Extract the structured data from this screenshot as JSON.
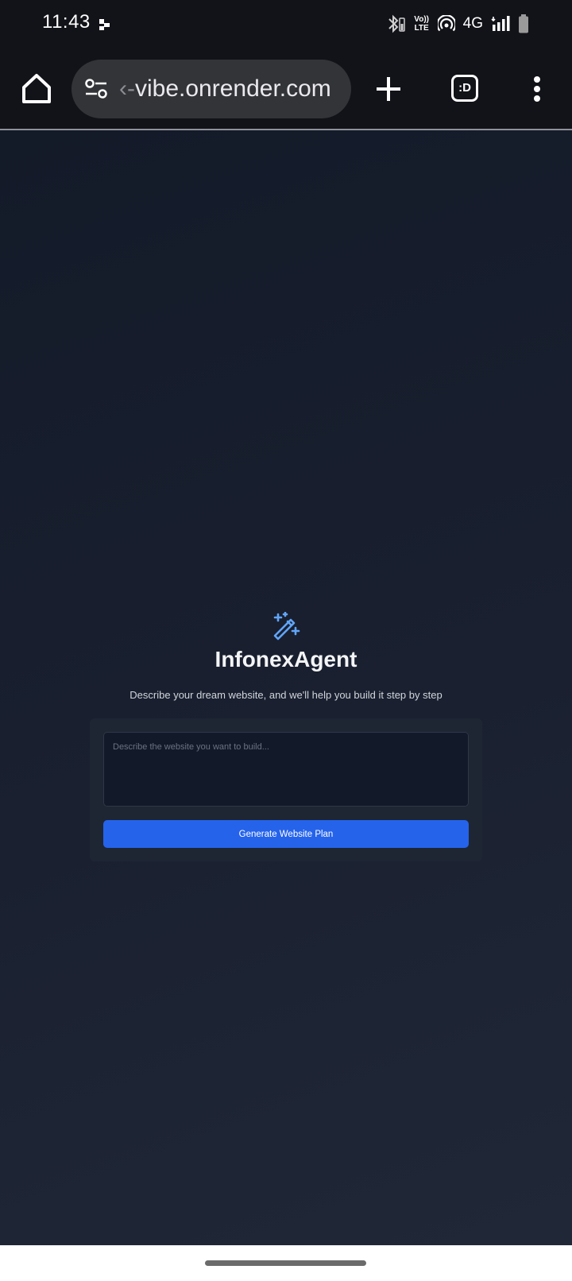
{
  "status_bar": {
    "time": "11:43",
    "network_type": "4G",
    "volte_line1": "Vo))",
    "volte_line2": "LTE",
    "icons": [
      "notification-dots-icon",
      "bluetooth-icon",
      "volte-icon",
      "hotspot-icon",
      "signal-icon",
      "battery-icon"
    ]
  },
  "browser": {
    "url_fade": "‹-",
    "url": "vibe.onrender.com",
    "tabs_label": ":D",
    "icons": [
      "home-icon",
      "site-settings-icon",
      "plus-icon",
      "more-vert-icon"
    ]
  },
  "page": {
    "title": "InfonexAgent",
    "subtitle": "Describe your dream website, and we'll help you build it step by step",
    "input": {
      "placeholder": "Describe the website you want to build...",
      "value": ""
    },
    "generate_button_label": "Generate Website Plan",
    "logo_icon": "magic-wand-icon"
  },
  "colors": {
    "accent": "#2563eb",
    "logo": "#60a5fa",
    "background": "#1a2030",
    "card": "#1e2533"
  }
}
